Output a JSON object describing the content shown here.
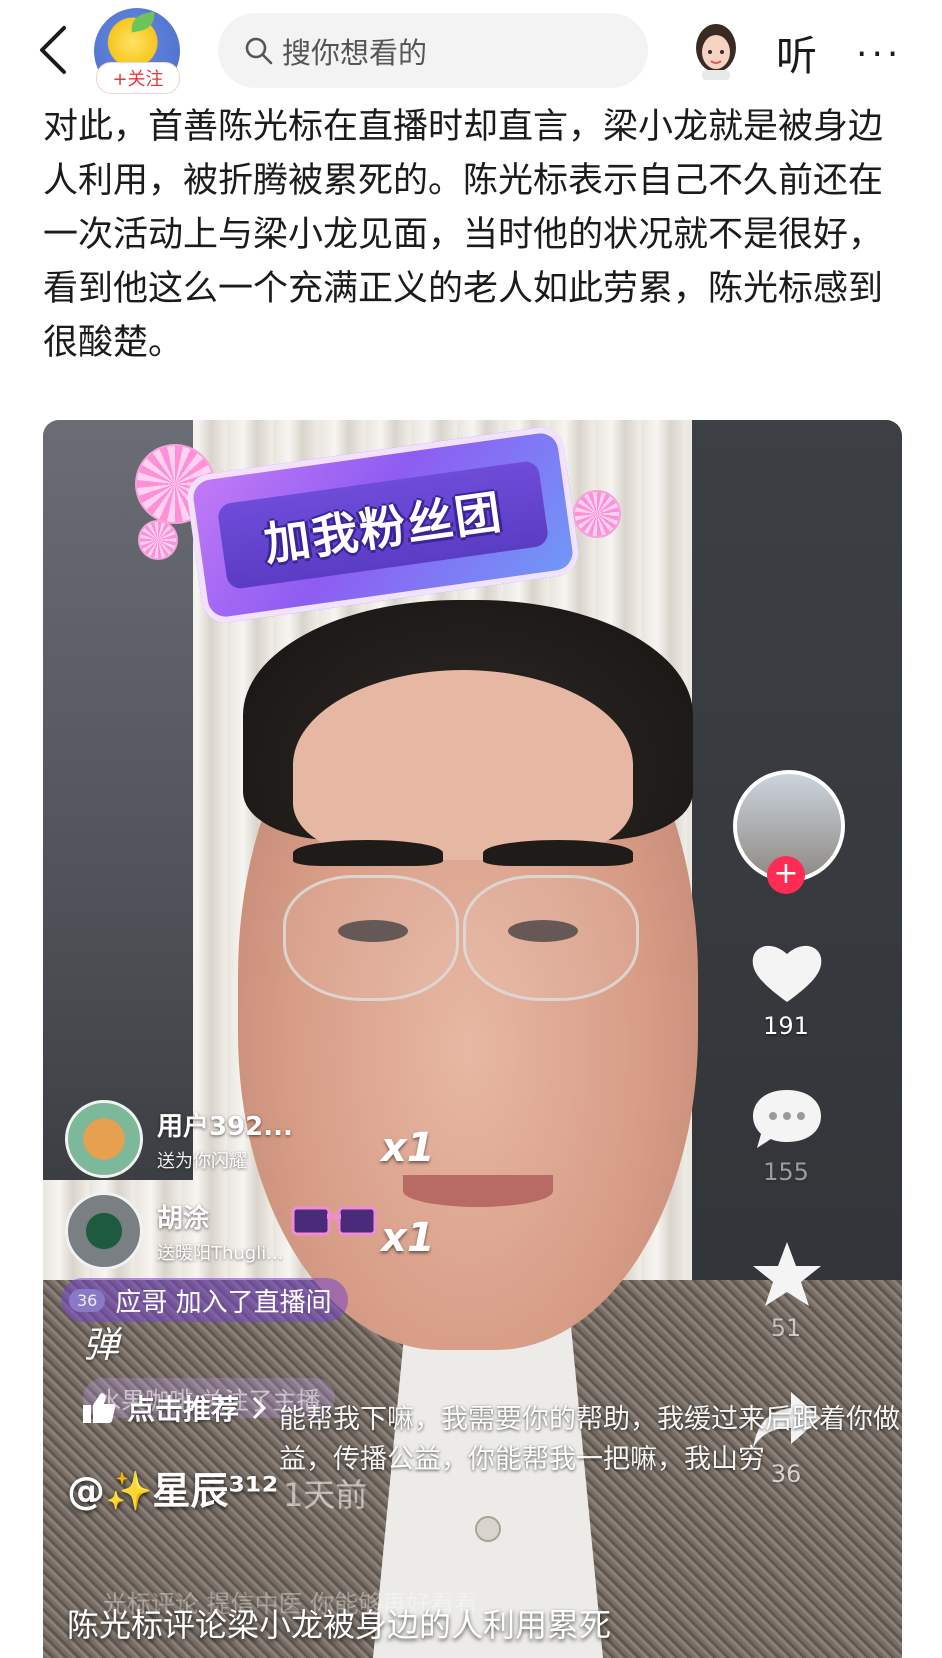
{
  "header": {
    "back_icon": "chevron-left-icon",
    "follow_label": "+关注",
    "search_placeholder": "搜你想看的",
    "listen_label": "听",
    "more_label": "···"
  },
  "article": {
    "text": "对此，首善陈光标在直播时却直言，梁小龙就是被身边人利用，被折腾被累死的。陈光标表示自己不久前还在一次活动上与梁小龙见面，当时他的状况就不是很好，看到他这么一个充满正义的老人如此劳累，陈光标感到很酸楚。"
  },
  "video": {
    "fan_club_sticker": "加我粉丝团",
    "gifts": [
      {
        "user": "用户392...",
        "sub": "送为你闪耀",
        "count": "x1"
      },
      {
        "user": "胡涂",
        "sub": "送暖阳Thugli...",
        "count": "x1"
      }
    ],
    "join_message": {
      "level": "36",
      "text": "应哥 加入了直播间"
    },
    "danmu_label": "弹",
    "follow_notice": "水果咖啡 关注了主播",
    "recommend_label": "点击推荐",
    "comment": "能帮我下嘛，我需要你的帮助，我缓过来后跟着你做公益，传播公益，你能帮我一把嘛，我山穷",
    "author": "@✨星辰³¹²",
    "time_ago": "1天前",
    "hidden_caption": "光标评论   提信中医   你能够再好看看",
    "title": "陈光标评论梁小龙被身边的人利用累死",
    "rail": {
      "likes": "191",
      "comments": "155",
      "favorites": "51",
      "shares": "36"
    }
  }
}
